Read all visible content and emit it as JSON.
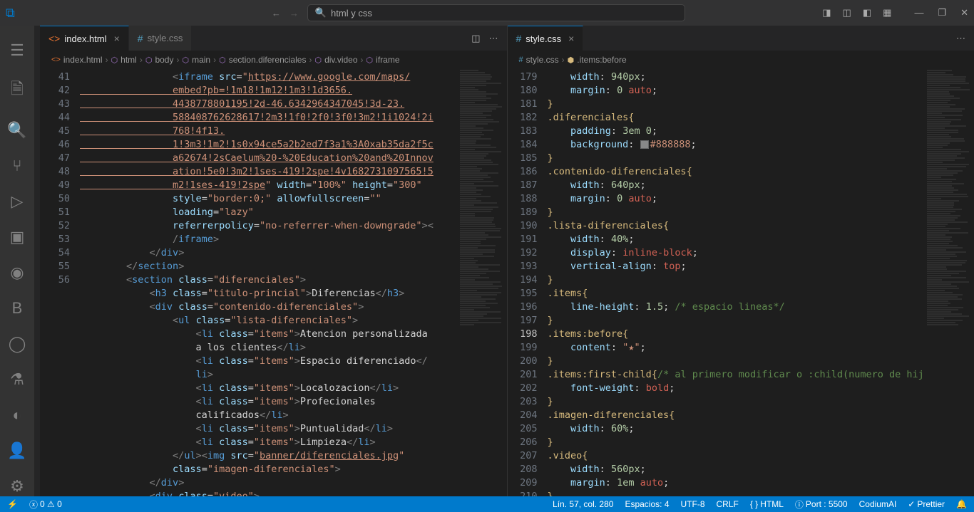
{
  "titlebar": {
    "search_text": "html y css"
  },
  "tabs": {
    "left": [
      {
        "name": "index.html",
        "active": true
      },
      {
        "name": "style.css",
        "active": false
      }
    ],
    "right": [
      {
        "name": "style.css",
        "active": true
      }
    ]
  },
  "breadcrumbs": {
    "left": [
      "index.html",
      "html",
      "body",
      "main",
      "section.diferenciales",
      "div.video",
      "iframe"
    ],
    "right": [
      "style.css",
      ".items:before"
    ]
  },
  "gutter_left": [
    "41",
    "",
    "",
    "",
    "",
    "",
    "",
    "",
    "",
    "",
    "",
    "",
    "",
    "42",
    "43",
    "44",
    "45",
    "46",
    "47",
    "48",
    "",
    "49",
    "",
    "50",
    "51",
    "",
    "52",
    "53",
    "54",
    "",
    "55",
    "56"
  ],
  "gutter_right": [
    "179",
    "180",
    "181",
    "182",
    "183",
    "184",
    "185",
    "186",
    "187",
    "188",
    "189",
    "190",
    "191",
    "192",
    "193",
    "194",
    "195",
    "196",
    "197",
    "198",
    "199",
    "200",
    "201",
    "202",
    "203",
    "204",
    "205",
    "206",
    "207",
    "208",
    "209",
    "210"
  ],
  "statusbar": {
    "remote": "",
    "errors_warnings": "0 ⚠ 0",
    "line_col": "Lín. 57, col. 280",
    "spaces": "Espacios: 4",
    "encoding": "UTF-8",
    "eol": "CRLF",
    "language": "HTML",
    "port": "Port : 5500",
    "codium": "CodiumAI",
    "prettier": "Prettier",
    "bell": "🔔"
  },
  "chart_data": {
    "type": "code-editor",
    "left_file": "index.html",
    "right_file": "style.css",
    "left_language": "HTML",
    "right_language": "CSS"
  }
}
